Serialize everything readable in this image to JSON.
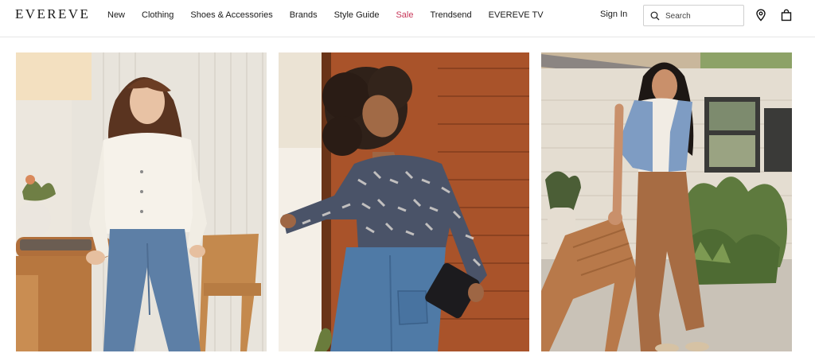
{
  "header": {
    "logo": "EVEREVE",
    "nav": [
      "New",
      "Clothing",
      "Shoes & Accessories",
      "Brands",
      "Style Guide",
      "Sale",
      "Trendsend",
      "EVEREVE TV"
    ],
    "signin": "Sign In",
    "search_placeholder": "Search",
    "icons": [
      "search-icon",
      "location-pin-icon",
      "shopping-bag-icon"
    ],
    "accent_sale_color": "#c8375a"
  },
  "tiles": [
    {
      "name": "white-cardigan-wide-leg-jeans"
    },
    {
      "name": "printed-blouse-jeans"
    },
    {
      "name": "denim-vest-brown-pants"
    }
  ]
}
